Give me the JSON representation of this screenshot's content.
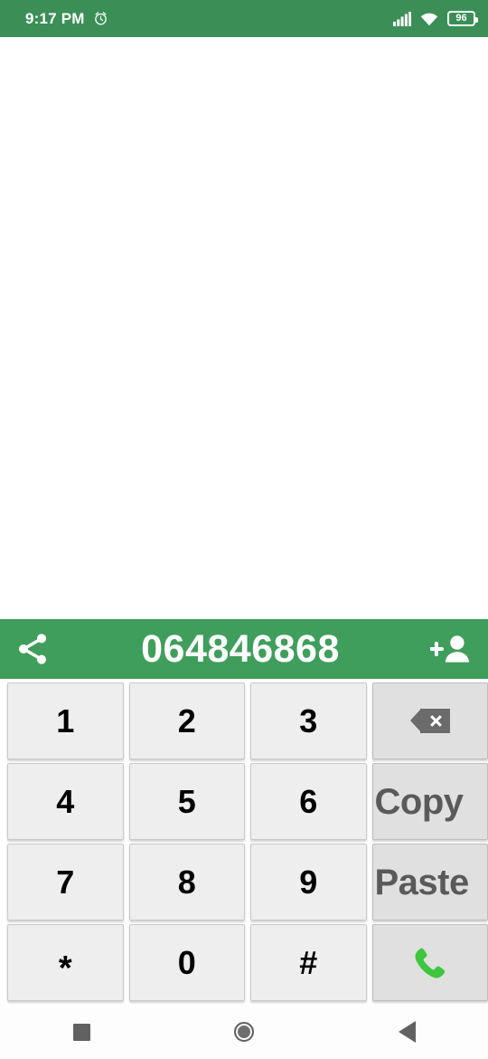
{
  "status_bar": {
    "time": "9:17 PM",
    "alarm_icon": "alarm-clock-icon",
    "signal_icon": "signal-bars-icon",
    "wifi_icon": "wifi-icon",
    "battery_level": "96",
    "background_color": "#3b8f56"
  },
  "number_bar": {
    "share_icon": "share-icon",
    "dialed_number": "064846868",
    "add_contact_icon": "add-contact-icon",
    "background_color": "#409e5c",
    "text_color": "#ffffff"
  },
  "keypad": {
    "keys": [
      {
        "label": "1",
        "name": "key-1",
        "type": "digit"
      },
      {
        "label": "2",
        "name": "key-2",
        "type": "digit"
      },
      {
        "label": "3",
        "name": "key-3",
        "type": "digit"
      },
      {
        "label": "",
        "name": "key-backspace",
        "type": "backspace"
      },
      {
        "label": "4",
        "name": "key-4",
        "type": "digit"
      },
      {
        "label": "5",
        "name": "key-5",
        "type": "digit"
      },
      {
        "label": "6",
        "name": "key-6",
        "type": "digit"
      },
      {
        "label": "Copy",
        "name": "key-copy",
        "type": "text"
      },
      {
        "label": "7",
        "name": "key-7",
        "type": "digit"
      },
      {
        "label": "8",
        "name": "key-8",
        "type": "digit"
      },
      {
        "label": "9",
        "name": "key-9",
        "type": "digit"
      },
      {
        "label": "Paste",
        "name": "key-paste",
        "type": "text"
      },
      {
        "label": "*",
        "name": "key-star",
        "type": "digit"
      },
      {
        "label": "0",
        "name": "key-0",
        "type": "digit"
      },
      {
        "label": "#",
        "name": "key-hash",
        "type": "digit"
      },
      {
        "label": "",
        "name": "key-call",
        "type": "call"
      }
    ],
    "key_background": "#eeeeee",
    "fn_key_background": "#e0e0e0",
    "label_text_color": "#5a5a5a",
    "call_icon_color": "#3ec63e",
    "backspace_icon_color": "#6b6b6b"
  },
  "nav_bar": {
    "recents_icon": "square-recents-icon",
    "home_icon": "circle-home-icon",
    "back_icon": "triangle-back-icon",
    "icon_color": "#616161"
  }
}
